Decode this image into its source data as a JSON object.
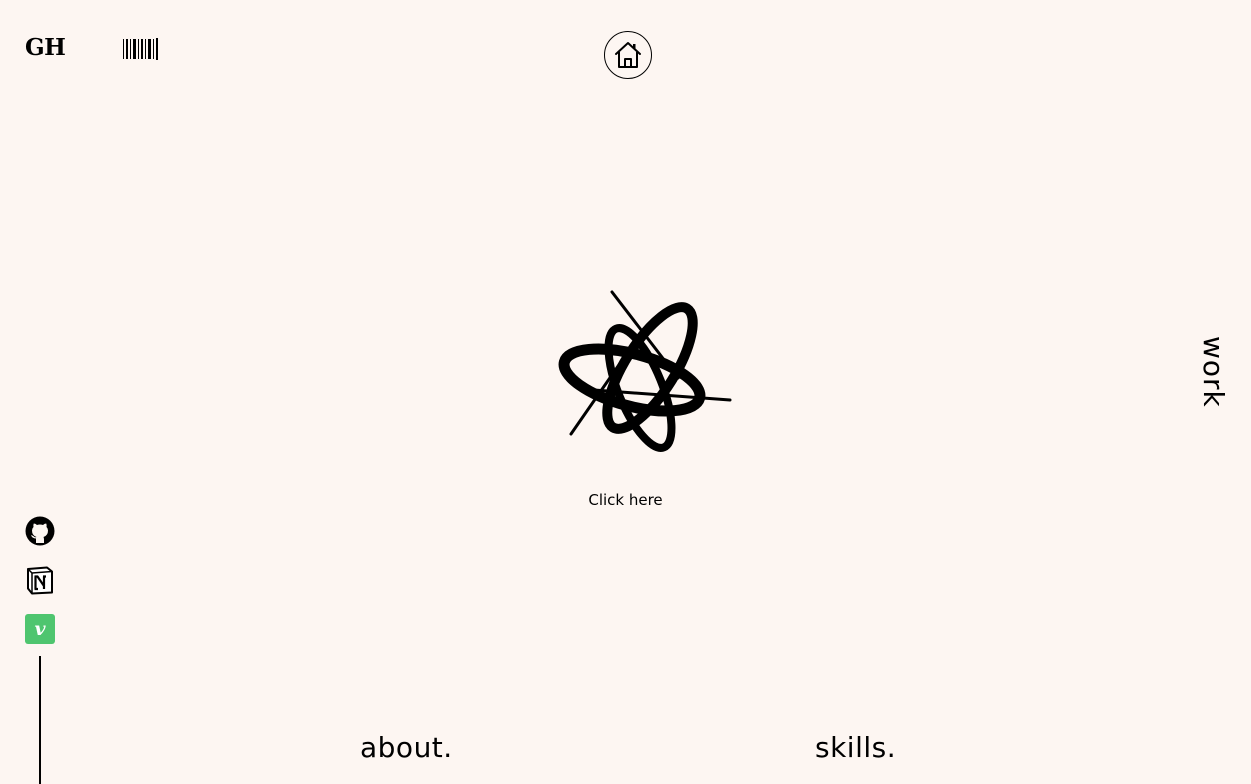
{
  "header": {
    "logo_text": "GH",
    "barcode_icon": "barcode-icon",
    "home_icon": "home-icon"
  },
  "main": {
    "emblem_icon": "star-swirl-emblem",
    "cta_text": "Click here"
  },
  "nav": {
    "work": "work",
    "about": "about.",
    "skills": "skills."
  },
  "social": {
    "github_icon": "github-icon",
    "notion_icon": "notion-icon",
    "vimeo_icon": "vimeo-icon",
    "vimeo_glyph": "v"
  },
  "colors": {
    "background": "#fdf6f2",
    "text": "#000000",
    "vimeo": "#4fc56f"
  }
}
